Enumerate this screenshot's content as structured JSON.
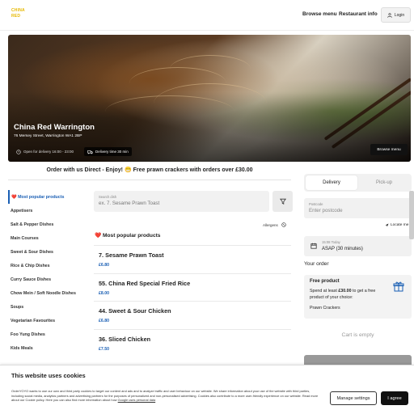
{
  "header": {
    "logo_line1": "CHINA",
    "logo_line2": "RED",
    "nav_browse": "Browse menu",
    "nav_info": "Restaurant info",
    "login_label": "Login"
  },
  "hero": {
    "title": "China Red Warrington",
    "address": "76 Mersey Street, Warrington WA1 2BP",
    "open_text": "Open for delivery 16:00 - 23:00",
    "delivery_text": "Delivery time 30 min",
    "browse_button": "Browse menu"
  },
  "promo": "Order with us Direct - Enjoy! 😁 Free prawn crackers with orders over £30.00",
  "categories": [
    "❤️ Most popular products",
    "Appetisers",
    "Salt & Pepper Dishes",
    "Main Courses",
    "Sweet & Sour Dishes",
    "Rice & Chip Dishes",
    "Curry Sauce Dishes",
    "Chow Mein / Soft Noodle Dishes",
    "Soups",
    "Vegetarian Favourites",
    "Foo Yung Dishes",
    "Kids Meals"
  ],
  "search": {
    "label": "Search dish",
    "placeholder": "ex. 7. Sesame Prawn Toast"
  },
  "allergens_label": "Allergens",
  "section_title": "❤️ Most popular products",
  "dishes": [
    {
      "name": "7. Sesame Prawn Toast",
      "price": "£6.80"
    },
    {
      "name": "55. China Red Special Fried Rice",
      "price": "£8.00"
    },
    {
      "name": "44. Sweet & Sour Chicken",
      "price": "£6.80"
    },
    {
      "name": "36. Sliced Chicken",
      "price": "£7.50"
    }
  ],
  "order_panel": {
    "tab_delivery": "Delivery",
    "tab_pickup": "Pick-up",
    "postcode_label": "Postcode",
    "postcode_placeholder": "Enter postcode",
    "locate": "Locate me",
    "time_label": "15:08 Today",
    "time_value": "ASAP (30 minutes)",
    "your_order": "Your order",
    "free_title": "Free product",
    "free_text_pre": "Spend at least ",
    "free_amount": "£30.00",
    "free_text_post": " to get a free product of your choice:",
    "free_item": "Prawn Crackers",
    "cart_empty": "Cart is empty"
  },
  "cookie": {
    "title": "This website uses cookies",
    "text": "OrderYOYO wants to use our own and third party cookies to target our content and ads and to analyze traffic and user behaviour on our website. We share information about your use of the website with third parties, including social media, analytics partners and advertising partners for the purposes of personalized and non-personalised advertising. Cookies also contribute to a more user-friendly experience on our website. Read more about our Cookie policy. Here you can also find more information about how ",
    "link": "Google uses personal data",
    "settings_button": "Manage settings",
    "agree_button": "I agree"
  },
  "colors": {
    "accent": "#1a5fb4",
    "logo": "#e6b800",
    "dark": "#111111"
  }
}
